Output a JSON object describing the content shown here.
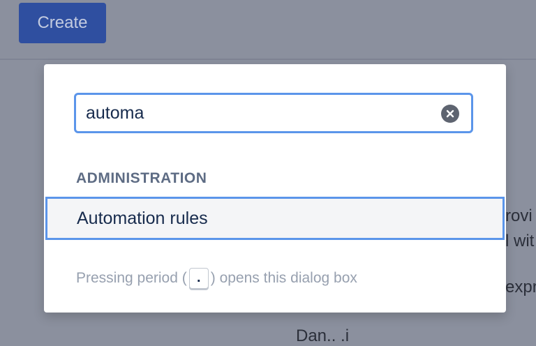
{
  "topbar": {
    "create_label": "Create"
  },
  "background": {
    "text1": "rovi",
    "text2": "l wit",
    "text3": "expr",
    "text4": "Dan.. .i"
  },
  "dialog": {
    "search_value": "automa",
    "section_heading": "ADMINISTRATION",
    "results": [
      {
        "label": "Automation rules"
      }
    ],
    "hint_before": "Pressing period (",
    "hint_key": ".",
    "hint_after": ") opens this dialog box"
  },
  "colors": {
    "focus": "#5b95ea",
    "brand": "#2f4fa0",
    "overlay": "#8b909e"
  },
  "icons": {
    "clear": "clear-icon"
  }
}
